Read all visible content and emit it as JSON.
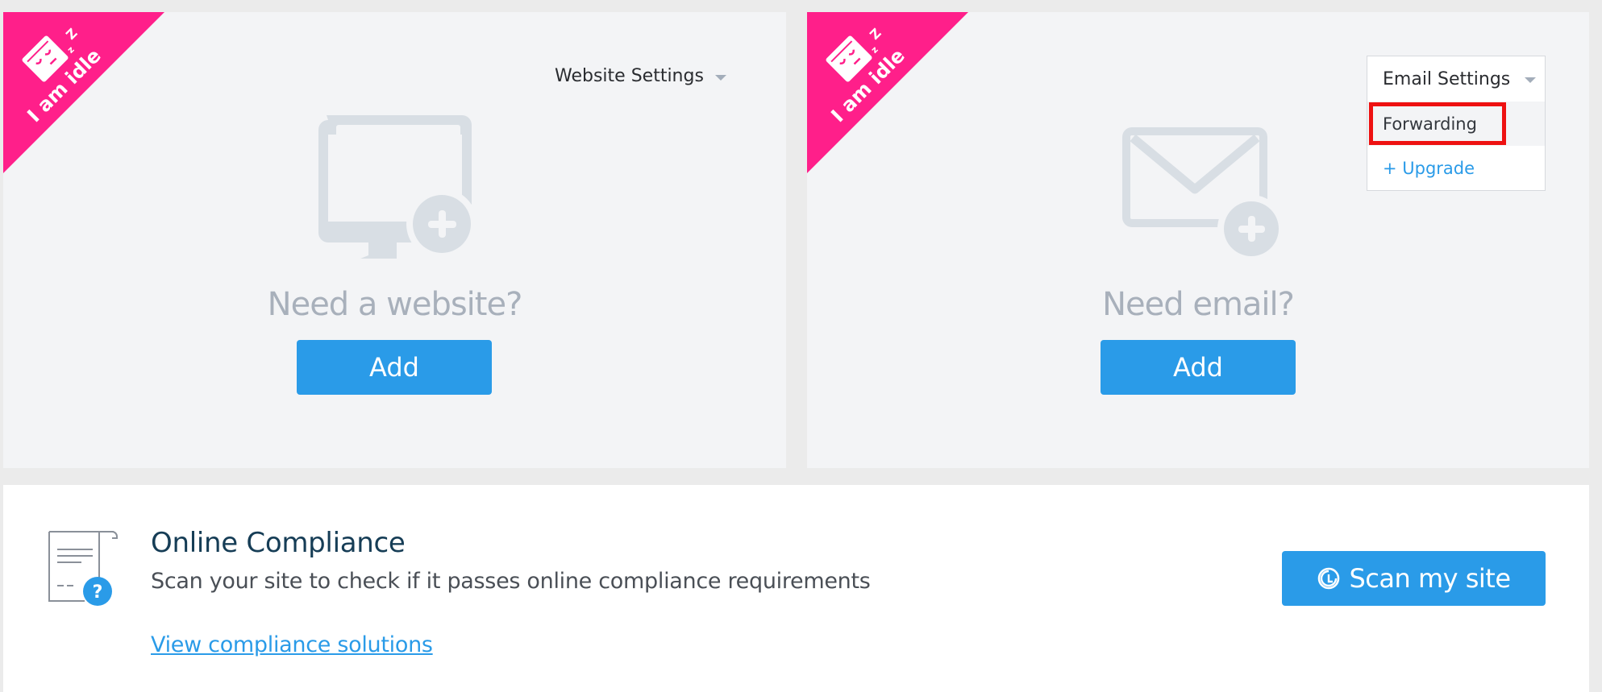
{
  "website_card": {
    "badge_text": "I am idle",
    "settings_label": "Website Settings",
    "title": "Need a website?",
    "add_label": "Add"
  },
  "email_card": {
    "badge_text": "I am idle",
    "settings_label": "Email Settings",
    "menu_items": [
      {
        "label": "Forwarding",
        "highlighted": true
      },
      {
        "label": "+ Upgrade"
      }
    ],
    "title": "Need email?",
    "add_label": "Add"
  },
  "compliance": {
    "title": "Online Compliance",
    "description": "Scan your site to check if it passes online compliance requirements",
    "link_label": "View compliance solutions",
    "scan_label": "Scan my site"
  },
  "colors": {
    "accent": "#2a9be8",
    "badge": "#ff1f8a",
    "highlight": "#ee1111",
    "heading": "#163d56"
  }
}
